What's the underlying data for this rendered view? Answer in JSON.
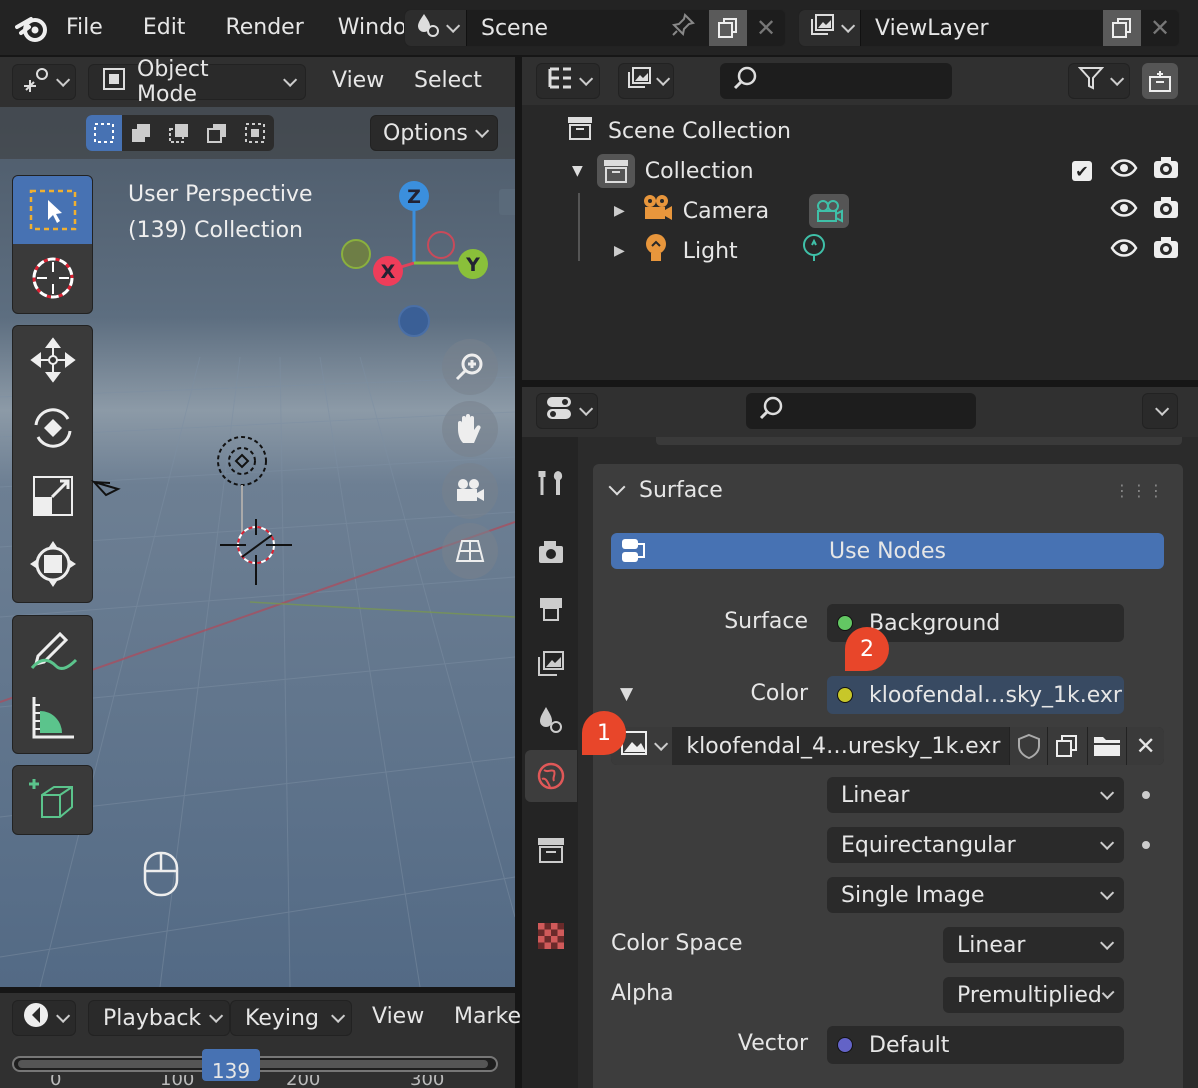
{
  "topbar": {
    "menu": [
      "File",
      "Edit",
      "Render",
      "Window"
    ],
    "scene_name": "Scene",
    "viewlayer_name": "ViewLayer"
  },
  "viewport": {
    "mode": "Object Mode",
    "menu": [
      "View",
      "Select"
    ],
    "options_label": "Options",
    "overlay_line1": "User Perspective",
    "overlay_line2": "(139) Collection",
    "gizmo": {
      "z": "Z",
      "x": "X",
      "y": "Y"
    }
  },
  "timeline": {
    "menu": [
      "Playback",
      "Keying",
      "View",
      "Marke"
    ],
    "ticks": [
      "0",
      "100",
      "139",
      "200",
      "300"
    ],
    "current_frame": "139"
  },
  "outliner": {
    "search_placeholder": "",
    "scene_collection": "Scene Collection",
    "collection": "Collection",
    "items": [
      "Camera",
      "Light"
    ]
  },
  "properties": {
    "search_placeholder": "",
    "panel_title": "Surface",
    "use_nodes_label": "Use Nodes",
    "surface_label": "Surface",
    "surface_value": "Background",
    "color_label": "Color",
    "color_value": "kloofendal…sky_1k.exr",
    "image_name": "kloofendal_4…uresky_1k.exr",
    "interpolation": "Linear",
    "projection": "Equirectangular",
    "source": "Single Image",
    "color_space_label": "Color Space",
    "color_space_value": "Linear",
    "alpha_label": "Alpha",
    "alpha_value": "Premultiplied",
    "vector_label": "Vector",
    "vector_value": "Default",
    "colors": {
      "accent": "#4772b3",
      "socket_green": "#63c763",
      "socket_yellow": "#c7c729",
      "socket_blue": "#6363c7"
    }
  },
  "callouts": [
    "1",
    "2"
  ]
}
